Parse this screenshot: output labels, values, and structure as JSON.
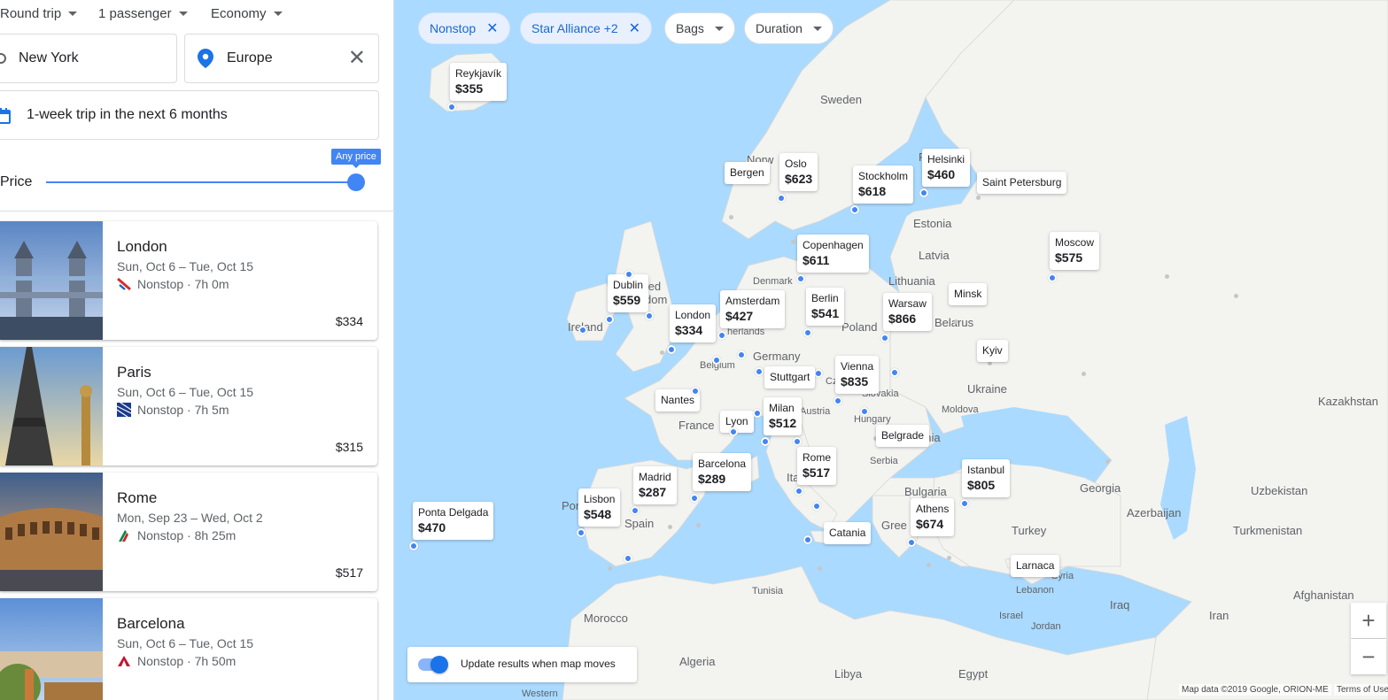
{
  "trip_options": {
    "trip_type": "Round trip",
    "passengers": "1 passenger",
    "cabin": "Economy"
  },
  "search": {
    "origin": "New York",
    "destination": "Europe",
    "dates": "1-week trip in the next 6 months"
  },
  "price_filter": {
    "label": "Price",
    "tooltip": "Any price",
    "level_percent": 100
  },
  "results": [
    {
      "city": "London",
      "dates": "Sun, Oct 6 – Tue, Oct 15",
      "flight": "Nonstop · 7h 0m",
      "price": "$334"
    },
    {
      "city": "Paris",
      "dates": "Sun, Oct 6 – Tue, Oct 15",
      "flight": "Nonstop · 7h 5m",
      "price": "$315"
    },
    {
      "city": "Rome",
      "dates": "Mon, Sep 23 – Wed, Oct 2",
      "flight": "Nonstop · 8h 25m",
      "price": "$517"
    },
    {
      "city": "Barcelona",
      "dates": "Sun, Oct 6 – Tue, Oct 15",
      "flight": "Nonstop · 7h 50m",
      "price": "$289"
    }
  ],
  "filters": {
    "nonstop": "Nonstop",
    "alliance": "Star Alliance +2",
    "bags": "Bags",
    "duration": "Duration"
  },
  "map_labels": {
    "sweden": "Sweden",
    "norway": "Norw",
    "finland": "F",
    "estonia": "Estonia",
    "latvia": "Latvia",
    "lithuania": "Lithuania",
    "belarus": "Belarus",
    "ukraine": "Ukraine",
    "kazakhstan": "Kazakhstan",
    "moldova": "Moldova",
    "hungary": "Hungary",
    "slovakia": "Slovakia",
    "czech": "Czech",
    "austria": "Austria",
    "germany": "Germany",
    "poland": "Poland",
    "denmark": "Denmark",
    "netherlands": "herlands",
    "belgium": "Belgium",
    "ireland": "Ireland",
    "uk": "ted\ndom",
    "france": "France",
    "spain": "Spain",
    "portugal": "Por",
    "italy": "Ita",
    "serbia": "Serbia",
    "romania": "ania",
    "bulgaria": "Bulgaria",
    "greece": "Gree",
    "turkey": "Turkey",
    "georgia": "Georgia",
    "azerbaijan": "Azerbaijan",
    "uzbekistan": "Uzbekistan",
    "turkmenistan": "Turkmenistan",
    "afghanistan": "Afghanistan",
    "iran": "Iran",
    "iraq": "Iraq",
    "syria": "Syria",
    "lebanon": "Lebanon",
    "israel": "Israel",
    "jordan": "Jordan",
    "egypt": "Egypt",
    "libya": "Libya",
    "algeria": "Algeria",
    "tunisia": "Tunisia",
    "morocco": "Morocco",
    "western": "Western"
  },
  "destinations": [
    {
      "city": "Reykjavík",
      "price": "$355"
    },
    {
      "city": "Bergen",
      "price": ""
    },
    {
      "city": "Oslo",
      "price": "$623"
    },
    {
      "city": "Stockholm",
      "price": "$618"
    },
    {
      "city": "Helsinki",
      "price": "$460"
    },
    {
      "city": "Saint Petersburg",
      "price": ""
    },
    {
      "city": "Moscow",
      "price": "$575"
    },
    {
      "city": "Copenhagen",
      "price": "$611"
    },
    {
      "city": "Dublin",
      "price": "$559"
    },
    {
      "city": "London",
      "price": "$334"
    },
    {
      "city": "Amsterdam",
      "price": "$427"
    },
    {
      "city": "Berlin",
      "price": "$541"
    },
    {
      "city": "Warsaw",
      "price": "$866"
    },
    {
      "city": "Minsk",
      "price": ""
    },
    {
      "city": "Kyiv",
      "price": ""
    },
    {
      "city": "Vienna",
      "price": "$835"
    },
    {
      "city": "Stuttgart",
      "price": ""
    },
    {
      "city": "Nantes",
      "price": ""
    },
    {
      "city": "Lyon",
      "price": ""
    },
    {
      "city": "Milan",
      "price": "$512"
    },
    {
      "city": "Belgrade",
      "price": ""
    },
    {
      "city": "Rome",
      "price": "$517"
    },
    {
      "city": "Barcelona",
      "price": "$289"
    },
    {
      "city": "Madrid",
      "price": "$287"
    },
    {
      "city": "Lisbon",
      "price": "$548"
    },
    {
      "city": "Ponta Delgada",
      "price": "$470"
    },
    {
      "city": "Istanbul",
      "price": "$805"
    },
    {
      "city": "Athens",
      "price": "$674"
    },
    {
      "city": "Catania",
      "price": ""
    },
    {
      "city": "Larnaca",
      "price": ""
    }
  ],
  "map_controls": {
    "update_toggle": "Update results when map moves",
    "zoom_in": "+",
    "zoom_out": "−"
  },
  "attribution": {
    "map_data": "Map data ©2019 Google, ORION-ME",
    "terms": "Terms of Use"
  },
  "colors": {
    "accent": "#4285f4",
    "water": "#aadaff",
    "land": "#f5f5f3"
  }
}
